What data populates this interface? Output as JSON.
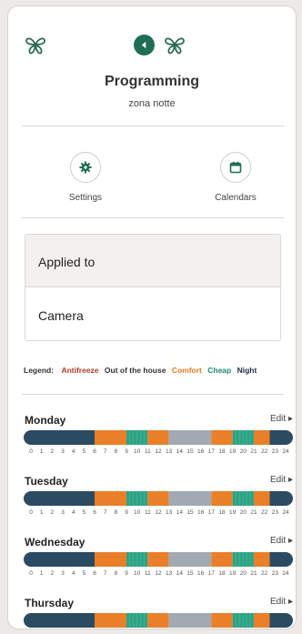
{
  "header": {
    "title": "Programming",
    "subtitle": "zona notte"
  },
  "actions": {
    "settings_label": "Settings",
    "calendars_label": "Calendars"
  },
  "applied": {
    "header": "Applied to",
    "value": "Camera"
  },
  "legend": {
    "label": "Legend:",
    "items": [
      {
        "label": "Antifreeze",
        "color": "#b23b28"
      },
      {
        "label": "Out of the house",
        "color": "#333333"
      },
      {
        "label": "Comfort",
        "color": "#e07a22"
      },
      {
        "label": "Cheap",
        "color": "#1a8a6e"
      },
      {
        "label": "Night",
        "color": "#1c2f45"
      }
    ]
  },
  "mode_colors": {
    "Night": "#2b4b63",
    "Comfort": "#ea7f2a",
    "Cheap": "#2ea384",
    "Out of the house": "#a1aab3"
  },
  "hour_labels": [
    "0",
    "1",
    "2",
    "3",
    "4",
    "5",
    "6",
    "7",
    "8",
    "9",
    "10",
    "11",
    "12",
    "13",
    "14",
    "15",
    "16",
    "17",
    "18",
    "19",
    "20",
    "21",
    "22",
    "23",
    "24"
  ],
  "days": [
    {
      "name": "Monday",
      "edit_label": "Edit",
      "segments": [
        {
          "mode": "Night",
          "start": 0,
          "end": 6
        },
        {
          "mode": "Comfort",
          "start": 6,
          "end": 9
        },
        {
          "mode": "Cheap",
          "start": 9,
          "end": 11
        },
        {
          "mode": "Comfort",
          "start": 11,
          "end": 13
        },
        {
          "mode": "Out of the house",
          "start": 13,
          "end": 17
        },
        {
          "mode": "Comfort",
          "start": 17,
          "end": 19
        },
        {
          "mode": "Cheap",
          "start": 19,
          "end": 21
        },
        {
          "mode": "Comfort",
          "start": 21,
          "end": 22.5
        },
        {
          "mode": "Night",
          "start": 22.5,
          "end": 24
        }
      ]
    },
    {
      "name": "Tuesday",
      "edit_label": "Edit",
      "segments": [
        {
          "mode": "Night",
          "start": 0,
          "end": 6
        },
        {
          "mode": "Comfort",
          "start": 6,
          "end": 9
        },
        {
          "mode": "Cheap",
          "start": 9,
          "end": 11
        },
        {
          "mode": "Comfort",
          "start": 11,
          "end": 13
        },
        {
          "mode": "Out of the house",
          "start": 13,
          "end": 17
        },
        {
          "mode": "Comfort",
          "start": 17,
          "end": 19
        },
        {
          "mode": "Cheap",
          "start": 19,
          "end": 21
        },
        {
          "mode": "Comfort",
          "start": 21,
          "end": 22.5
        },
        {
          "mode": "Night",
          "start": 22.5,
          "end": 24
        }
      ]
    },
    {
      "name": "Wednesday",
      "edit_label": "Edit",
      "segments": [
        {
          "mode": "Night",
          "start": 0,
          "end": 6
        },
        {
          "mode": "Comfort",
          "start": 6,
          "end": 9
        },
        {
          "mode": "Cheap",
          "start": 9,
          "end": 11
        },
        {
          "mode": "Comfort",
          "start": 11,
          "end": 13
        },
        {
          "mode": "Out of the house",
          "start": 13,
          "end": 17
        },
        {
          "mode": "Comfort",
          "start": 17,
          "end": 19
        },
        {
          "mode": "Cheap",
          "start": 19,
          "end": 21
        },
        {
          "mode": "Comfort",
          "start": 21,
          "end": 22.5
        },
        {
          "mode": "Night",
          "start": 22.5,
          "end": 24
        }
      ]
    },
    {
      "name": "Thursday",
      "edit_label": "Edit",
      "segments": [
        {
          "mode": "Night",
          "start": 0,
          "end": 6
        },
        {
          "mode": "Comfort",
          "start": 6,
          "end": 9
        },
        {
          "mode": "Cheap",
          "start": 9,
          "end": 11
        },
        {
          "mode": "Comfort",
          "start": 11,
          "end": 13
        },
        {
          "mode": "Out of the house",
          "start": 13,
          "end": 17
        },
        {
          "mode": "Comfort",
          "start": 17,
          "end": 19
        },
        {
          "mode": "Cheap",
          "start": 19,
          "end": 21
        },
        {
          "mode": "Comfort",
          "start": 21,
          "end": 22.5
        },
        {
          "mode": "Night",
          "start": 22.5,
          "end": 24
        }
      ]
    }
  ]
}
